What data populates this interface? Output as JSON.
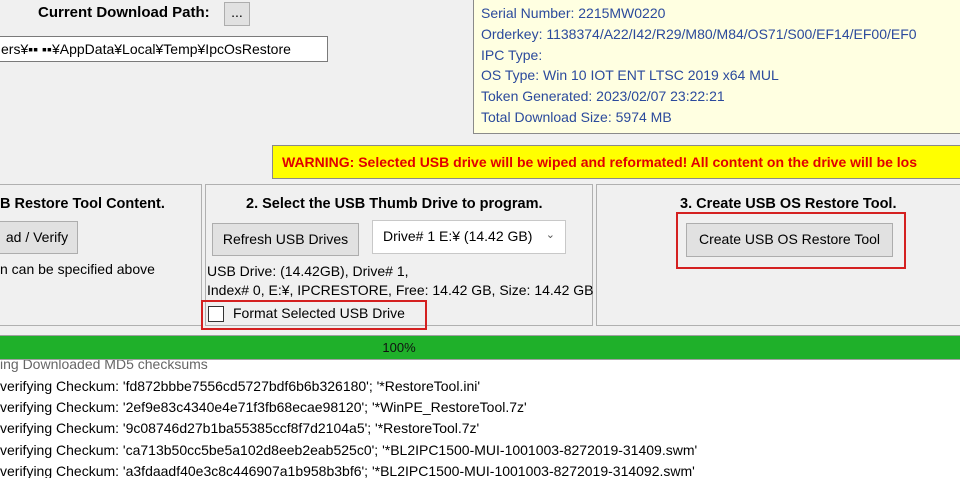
{
  "download": {
    "label": "Current Download Path:",
    "browse_label": "...",
    "path": "ers¥▪▪ ▪▪¥AppData¥Local¥Temp¥IpcOsRestore"
  },
  "info": {
    "lines": [
      "Serial Number: 2215MW0220",
      "Orderkey: 1138374/A22/I42/R29/M80/M84/OS71/S00/EF14/EF00/EF0",
      "IPC Type:",
      "OS Type: Win 10 IOT ENT LTSC 2019 x64 MUL",
      "Token Generated: 2023/02/07 23:22:21",
      "Total Download Size: 5974 MB"
    ]
  },
  "warning": "WARNING: Selected USB drive will be wiped and reformated! All content on the drive will be los",
  "step1": {
    "title": "B Restore Tool Content.",
    "button_label": "ad / Verify",
    "note": "n can be specified above"
  },
  "step2": {
    "title": "2. Select the USB Thumb Drive to program.",
    "refresh_label": "Refresh USB Drives",
    "drive_selected": "Drive# 1 E:¥ (14.42 GB)",
    "drive_info_line1": "USB Drive: (14.42GB), Drive# 1,",
    "drive_info_line2": "Index# 0, E:¥, IPCRESTORE, Free: 14.42 GB, Size: 14.42 GB",
    "format_label": "Format Selected USB Drive",
    "format_checked": false
  },
  "step3": {
    "title": "3. Create USB OS Restore Tool.",
    "create_label": "Create USB OS Restore Tool"
  },
  "progress": {
    "value": 1.0,
    "label": "100%"
  },
  "log": [
    "ing Downloaded MD5 checksums",
    "verifying Checkum: 'fd872bbbe7556cd5727bdf6b6b326180'; '*RestoreTool.ini'",
    "verifying Checkum: '2ef9e83c4340e4e71f3fb68ecae98120'; '*WinPE_RestoreTool.7z'",
    "verifying Checkum: '9c08746d27b1ba55385ccf8f7d2104a5'; '*RestoreTool.7z'",
    "verifying Checkum: 'ca713b50cc5be5a102d8eeb2eab525c0'; '*BL2IPC1500-MUI-1001003-8272019-31409.swm'",
    "verifying Checkum: 'a3fdaadf40e3c8c446907a1b958b3bf6'; '*BL2IPC1500-MUI-1001003-8272019-314092.swm'"
  ],
  "colors": {
    "info_text": "#2b4a9c",
    "info_bg": "#ffffe1",
    "warning_bg": "#ffff00",
    "warning_text": "#e00000",
    "progress": "#1fb02a",
    "highlight": "#d42020"
  }
}
